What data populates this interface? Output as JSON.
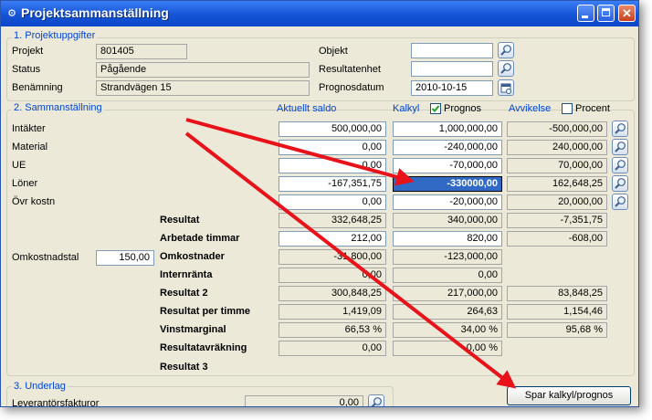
{
  "window": {
    "title": "Projektsammanställning"
  },
  "section1": {
    "legend": "1. Projektuppgifter",
    "projekt_label": "Projekt",
    "projekt_value": "801405",
    "status_label": "Status",
    "status_value": "Pågående",
    "benamning_label": "Benämning",
    "benamning_value": "Strandvägen 15",
    "objekt_label": "Objekt",
    "objekt_value": "",
    "resultatenhet_label": "Resultatenhet",
    "resultatenhet_value": "",
    "prognosdatum_label": "Prognosdatum",
    "prognosdatum_value": "2010-10-15"
  },
  "section2": {
    "legend": "2. Sammanställning",
    "col_aktuellt": "Aktuellt saldo",
    "col_kalkyl": "Kalkyl",
    "prognos_label": "Prognos",
    "prognos_checked": true,
    "col_avvikelse": "Avvikelse",
    "procent_label": "Procent",
    "procent_checked": false,
    "rows": [
      {
        "label": "Intäkter",
        "saldo": "500,000,00",
        "kalkyl": "1,000,000,00",
        "avvikelse": "-500,000,00"
      },
      {
        "label": "Material",
        "saldo": "0,00",
        "kalkyl": "-240,000,00",
        "avvikelse": "240,000,00"
      },
      {
        "label": "UE",
        "saldo": "0,00",
        "kalkyl": "-70,000,00",
        "avvikelse": "70,000,00"
      },
      {
        "label": "Löner",
        "saldo": "-167,351,75",
        "kalkyl": "-330000,00",
        "avvikelse": "162,648,25"
      },
      {
        "label": "Övr kostn",
        "saldo": "0,00",
        "kalkyl": "-20,000,00",
        "avvikelse": "20,000,00"
      }
    ],
    "resultat": {
      "label": "Resultat",
      "saldo": "332,648,25",
      "kalkyl": "340,000,00",
      "avvikelse": "-7,351,75"
    },
    "arbetade": {
      "label": "Arbetade timmar",
      "saldo": "212,00",
      "kalkyl": "820,00",
      "avvikelse": "-608,00"
    },
    "omkostnadstal": {
      "label": "Omkostnadstal",
      "value": "150,00"
    },
    "omkostnader": {
      "label": "Omkostnader",
      "saldo": "-31,800,00",
      "kalkyl": "-123,000,00"
    },
    "internranta": {
      "label": "Internränta",
      "saldo": "0,00",
      "kalkyl": "0,00"
    },
    "resultat2": {
      "label": "Resultat 2",
      "saldo": "300,848,25",
      "kalkyl": "217,000,00",
      "avvikelse": "83,848,25"
    },
    "resultat_per_timme": {
      "label": "Resultat per timme",
      "saldo": "1,419,09",
      "kalkyl": "264,63",
      "avvikelse": "1,154,46"
    },
    "vinstmarginal": {
      "label": "Vinstmarginal",
      "saldo": "66,53 %",
      "kalkyl": "34,00 %",
      "avvikelse": "95,68 %"
    },
    "resultatavrakning": {
      "label": "Resultatavräkning",
      "saldo": "0,00",
      "kalkyl": "0,00 %"
    },
    "resultat3": {
      "label": "Resultat 3"
    }
  },
  "section3": {
    "legend": "3. Underlag",
    "leverantor_label": "Leverantörsfakturor",
    "leverantor_value": "0,00"
  },
  "spar_button": "Spar kalkyl/prognos",
  "colors": {
    "title_bar": "#1553d6",
    "legend_text": "#0046d5",
    "selection": "#316ac5",
    "annotation_arrow": "#e8121a"
  }
}
